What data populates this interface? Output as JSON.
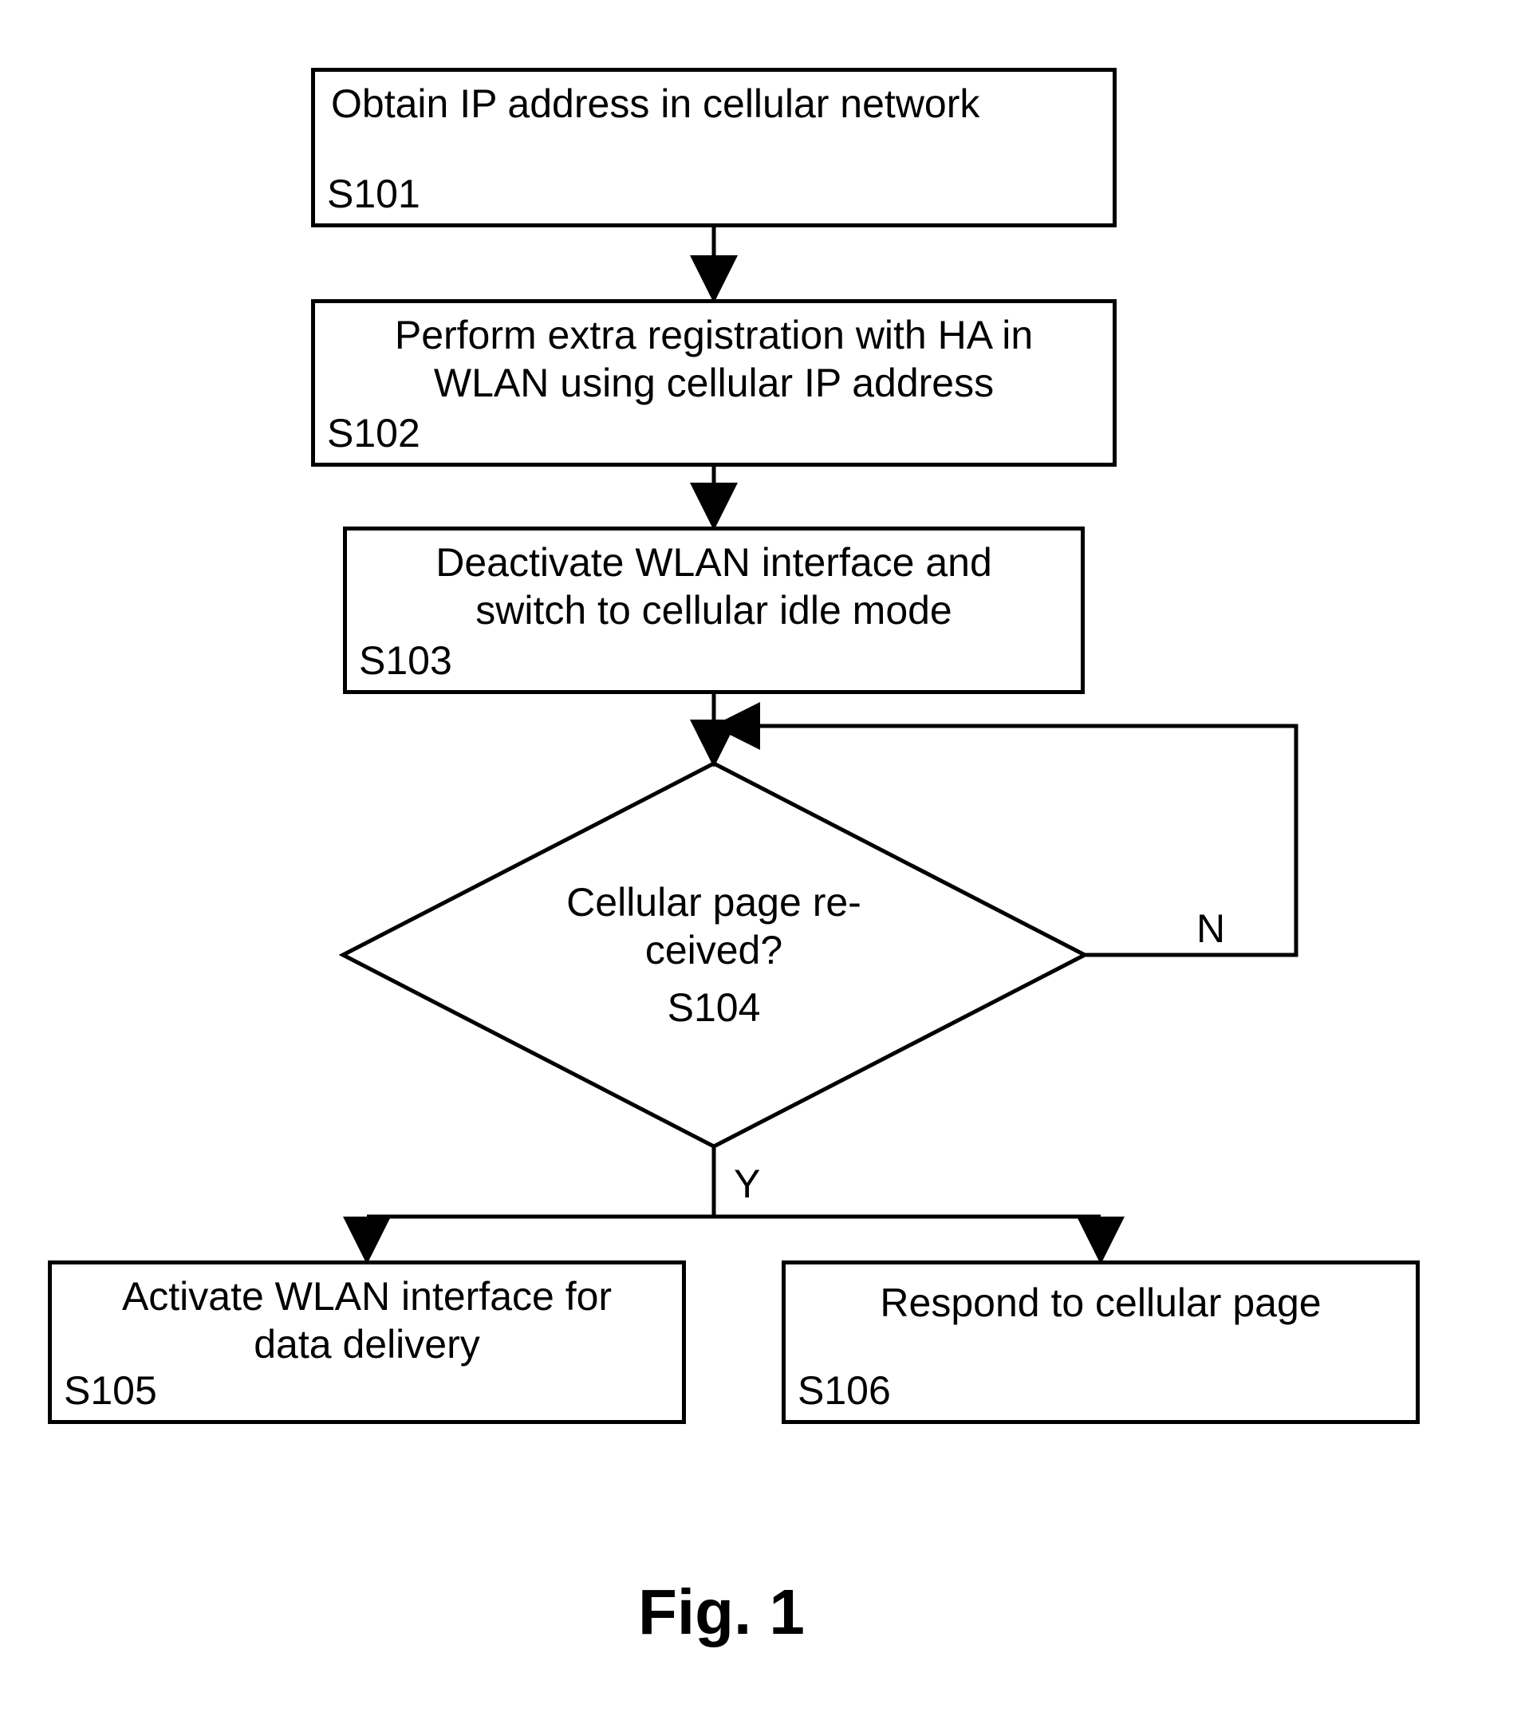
{
  "chart_data": {
    "type": "flowchart",
    "title": "Fig. 1",
    "nodes": [
      {
        "id": "S101",
        "kind": "process",
        "text": "Obtain IP address in cellular network"
      },
      {
        "id": "S102",
        "kind": "process",
        "text": "Perform extra registration with HA in WLAN using cellular IP address"
      },
      {
        "id": "S103",
        "kind": "process",
        "text": "Deactivate WLAN interface and switch to cellular idle mode"
      },
      {
        "id": "S104",
        "kind": "decision",
        "text": "Cellular page received?"
      },
      {
        "id": "S105",
        "kind": "process",
        "text": "Activate WLAN interface for data delivery"
      },
      {
        "id": "S106",
        "kind": "process",
        "text": "Respond to cellular page"
      }
    ],
    "edges": [
      {
        "from": "S101",
        "to": "S102",
        "label": ""
      },
      {
        "from": "S102",
        "to": "S103",
        "label": ""
      },
      {
        "from": "S103",
        "to": "S104",
        "label": ""
      },
      {
        "from": "S104",
        "to": "S104",
        "label": "N"
      },
      {
        "from": "S104",
        "to": "S105",
        "label": "Y"
      },
      {
        "from": "S104",
        "to": "S106",
        "label": "Y"
      }
    ]
  },
  "labels": {
    "yes": "Y",
    "no": "N"
  },
  "caption": "Fig. 1"
}
